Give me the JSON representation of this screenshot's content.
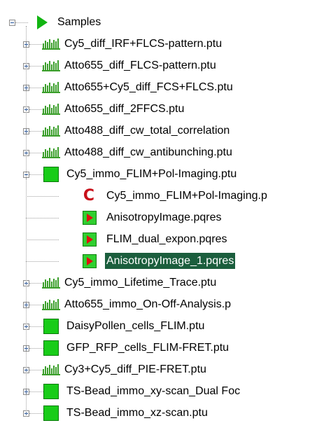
{
  "tree": {
    "root": {
      "label": "Samples",
      "icon": "play-arrow-icon",
      "expanded": true
    },
    "children": [
      {
        "label": "Cy5_diff_IRF+FLCS-pattern.ptu",
        "icon": "bars-icon",
        "expanded": false
      },
      {
        "label": "Atto655_diff_FLCS-pattern.ptu",
        "icon": "bars-icon",
        "expanded": false
      },
      {
        "label": "Atto655+Cy5_diff_FCS+FLCS.ptu",
        "icon": "bars-icon",
        "expanded": false
      },
      {
        "label": "Atto655_diff_2FFCS.ptu",
        "icon": "bars-icon",
        "expanded": false
      },
      {
        "label": "Atto488_diff_cw_total_correlation",
        "icon": "bars-icon",
        "expanded": false
      },
      {
        "label": "Atto488_diff_cw_antibunching.ptu",
        "icon": "bars-icon",
        "expanded": false
      },
      {
        "label": "Cy5_immo_FLIM+Pol-Imaging.ptu",
        "icon": "image-icon",
        "expanded": true,
        "children": [
          {
            "label": "Cy5_immo_FLIM+Pol-Imaging.p",
            "icon": "c-icon"
          },
          {
            "label": "AnisotropyImage.pqres",
            "icon": "result-icon"
          },
          {
            "label": "FLIM_dual_expon.pqres",
            "icon": "result-icon"
          },
          {
            "label": "AnisotropyImage_1.pqres",
            "icon": "result-icon",
            "selected": true
          }
        ]
      },
      {
        "label": "Cy5_immo_Lifetime_Trace.ptu",
        "icon": "bars-icon",
        "expanded": false
      },
      {
        "label": "Atto655_immo_On-Off-Analysis.p",
        "icon": "bars-icon",
        "expanded": false
      },
      {
        "label": "DaisyPollen_cells_FLIM.ptu",
        "icon": "image-icon",
        "expanded": false
      },
      {
        "label": "GFP_RFP_cells_FLIM-FRET.ptu",
        "icon": "image-icon",
        "expanded": false
      },
      {
        "label": "Cy3+Cy5_diff_PIE-FRET.ptu",
        "icon": "bars-icon",
        "expanded": false
      },
      {
        "label": "TS-Bead_immo_xy-scan_Dual Foc",
        "icon": "image-icon",
        "expanded": false
      },
      {
        "label": "TS-Bead_immo_xz-scan.ptu",
        "icon": "image-icon",
        "expanded": false
      }
    ]
  }
}
